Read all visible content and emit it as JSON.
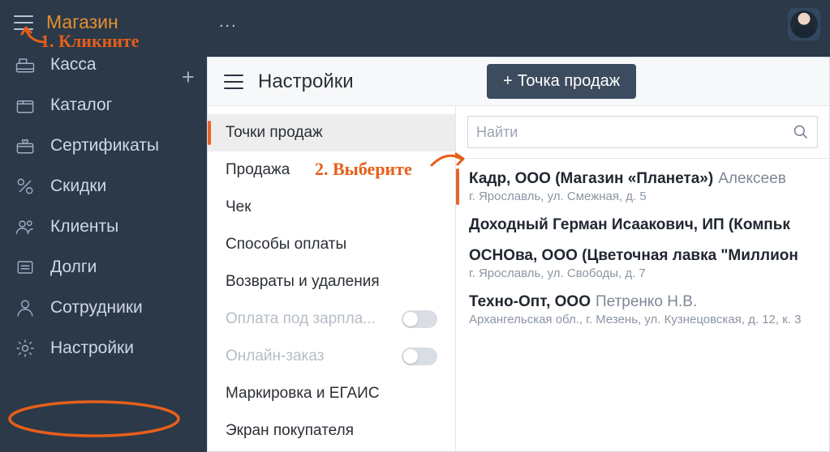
{
  "colors": {
    "accent": "#e9642a",
    "sidebar_bg": "#2b3949",
    "header_btn": "#3c4b5e"
  },
  "sidebar": {
    "brand": "Магазин",
    "items": [
      {
        "label": "Касса"
      },
      {
        "label": "Каталог"
      },
      {
        "label": "Сертификаты"
      },
      {
        "label": "Скидки"
      },
      {
        "label": "Клиенты"
      },
      {
        "label": "Долги"
      },
      {
        "label": "Сотрудники"
      },
      {
        "label": "Настройки"
      }
    ]
  },
  "topbar": {
    "ellipsis": "..."
  },
  "settings": {
    "title": "Настройки",
    "add_pos_label": "Точка продаж",
    "categories": [
      {
        "label": "Точки продаж",
        "state": "active"
      },
      {
        "label": "Продажа",
        "state": "normal"
      },
      {
        "label": "Чек",
        "state": "normal"
      },
      {
        "label": "Способы оплаты",
        "state": "normal"
      },
      {
        "label": "Возвраты и удаления",
        "state": "normal"
      },
      {
        "label": "Оплата под зарпла...",
        "state": "disabled_toggle"
      },
      {
        "label": "Онлайн-заказ",
        "state": "disabled_toggle"
      },
      {
        "label": "Маркировка и ЕГАИС",
        "state": "normal"
      },
      {
        "label": "Экран покупателя",
        "state": "normal"
      }
    ],
    "search": {
      "placeholder": "Найти"
    },
    "pos_entries": [
      {
        "primary": "Кадр, ООО (Магазин «Планета»)",
        "secondary": "Алексеев",
        "address": "г. Ярославль, ул. Смежная, д. 5",
        "selected": true
      },
      {
        "primary": "Доходный Герман Исаакович, ИП (Компьк",
        "secondary": "",
        "address": ""
      },
      {
        "primary": "ОСНОва, ООО (Цветочная лавка \"Миллион",
        "secondary": "",
        "address": "г. Ярославль, ул. Свободы, д. 7"
      },
      {
        "primary": "Техно-Опт, ООО",
        "secondary": "Петренко Н.В.",
        "address": "Архангельская обл., г. Мезень, ул. Кузнецовская, д. 12, к. 3"
      }
    ]
  },
  "annotations": {
    "step1": "1. Кликните",
    "step2": "2. Выберите"
  }
}
